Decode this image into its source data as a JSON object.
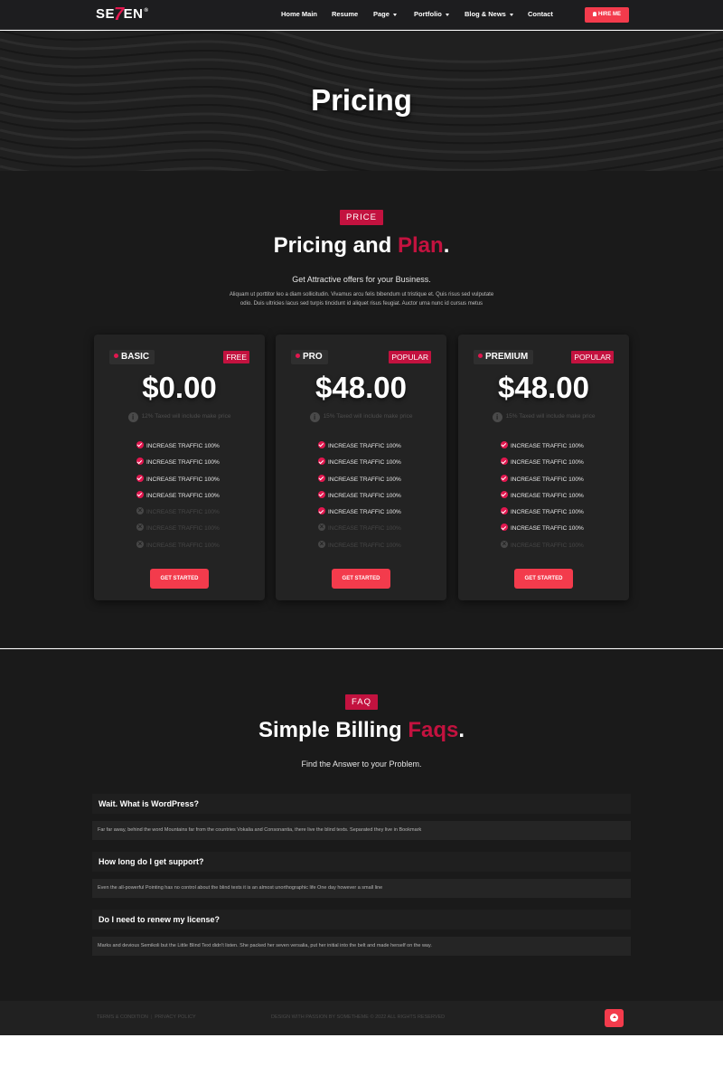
{
  "nav": {
    "logo": {
      "pre": "SE",
      "seven": "7",
      "post": "EN",
      "reg": "®"
    },
    "items": [
      {
        "label": "Home Main",
        "dropdown": false
      },
      {
        "label": "Resume",
        "dropdown": false
      },
      {
        "label": "Page",
        "dropdown": true
      },
      {
        "label": "Portfolio",
        "dropdown": true
      },
      {
        "label": "Blog & News",
        "dropdown": true
      },
      {
        "label": "Contact",
        "dropdown": false
      }
    ],
    "hire_label": "HIRE ME"
  },
  "hero": {
    "title": "Pricing"
  },
  "pricing": {
    "badge": "PRICE",
    "title_main": "Pricing and ",
    "title_accent": "Plan",
    "title_end": ".",
    "subtitle": "Get Attractive offers for your Business.",
    "paragraph": "Aliquam ut porttitor leo a diam sollicitudin. Vivamus arcu felis bibendum ut tristique et. Quis risus sed vulputate odio. Duis ultricies lacus sed turpis tincidunt id aliquet risus feugiat. Auctor urna nunc id cursus metus",
    "plans": [
      {
        "name": "BASIC",
        "tag": "FREE",
        "price": "$0.00",
        "tax_note": "12% Taxed will include make price",
        "features": [
          {
            "label": "INCREASE TRAFFIC 100%",
            "included": true
          },
          {
            "label": "INCREASE TRAFFIC 100%",
            "included": true
          },
          {
            "label": "INCREASE TRAFFIC 100%",
            "included": true
          },
          {
            "label": "INCREASE TRAFFIC 100%",
            "included": true
          },
          {
            "label": "INCREASE TRAFFIC 100%",
            "included": false
          },
          {
            "label": "INCREASE TRAFFIC 100%",
            "included": false
          },
          {
            "label": "INCREASE TRAFFIC 100%",
            "included": false
          }
        ],
        "cta": "GET STARTED"
      },
      {
        "name": "PRO",
        "tag": "POPULAR",
        "price": "$48.00",
        "tax_note": "15% Taxed will include make price",
        "features": [
          {
            "label": "INCREASE TRAFFIC 100%",
            "included": true
          },
          {
            "label": "INCREASE TRAFFIC 100%",
            "included": true
          },
          {
            "label": "INCREASE TRAFFIC 100%",
            "included": true
          },
          {
            "label": "INCREASE TRAFFIC 100%",
            "included": true
          },
          {
            "label": "INCREASE TRAFFIC 100%",
            "included": true
          },
          {
            "label": "INCREASE TRAFFIC 100%",
            "included": false
          },
          {
            "label": "INCREASE TRAFFIC 100%",
            "included": false
          }
        ],
        "cta": "GET STARTED"
      },
      {
        "name": "PREMIUM",
        "tag": "POPULAR",
        "price": "$48.00",
        "tax_note": "15% Taxed will include make price",
        "features": [
          {
            "label": "INCREASE TRAFFIC 100%",
            "included": true
          },
          {
            "label": "INCREASE TRAFFIC 100%",
            "included": true
          },
          {
            "label": "INCREASE TRAFFIC 100%",
            "included": true
          },
          {
            "label": "INCREASE TRAFFIC 100%",
            "included": true
          },
          {
            "label": "INCREASE TRAFFIC 100%",
            "included": true
          },
          {
            "label": "INCREASE TRAFFIC 100%",
            "included": true
          },
          {
            "label": "INCREASE TRAFFIC 100%",
            "included": false
          }
        ],
        "cta": "GET STARTED"
      }
    ]
  },
  "faq": {
    "badge": "FAQ",
    "title_main": "Simple Billing ",
    "title_accent": "Faqs",
    "title_end": ".",
    "subtitle": "Find the Answer to your Problem.",
    "items": [
      {
        "question": "Wait. What is WordPress?",
        "answer": "Far far away, behind the word Mountains far from the countries Vokalia and Consonantia, there live the blind texts. Separated they live in Bookmark"
      },
      {
        "question": "How long do I get support?",
        "answer": "Even the all-powerful Pointing has no control about the blind texts it is an almost unorthographic life One day however a small line"
      },
      {
        "question": "Do I need to renew my license?",
        "answer": "Marks and devious Semikoli but the Little Blind Text didn't listen. She packed her seven versalia, put her initial into the belt and made herself on the way."
      }
    ]
  },
  "footer": {
    "terms": "TERMS & CONDITION",
    "privacy": "PRIVACY POLICY",
    "copyright": "DESIGN WITH PASSION BY SOMETHEME © 2022 ALL RIGHTS RESERVED"
  },
  "colors": {
    "accent": "#c3123f",
    "button": "#f33b4c",
    "background": "#1a1a1a",
    "card": "#232323"
  },
  "icons": {
    "hire": "bell-icon",
    "included": "check-circle-icon",
    "excluded": "x-circle-icon",
    "info": "info-icon",
    "back_to_top": "arrow-up-circle-icon"
  }
}
